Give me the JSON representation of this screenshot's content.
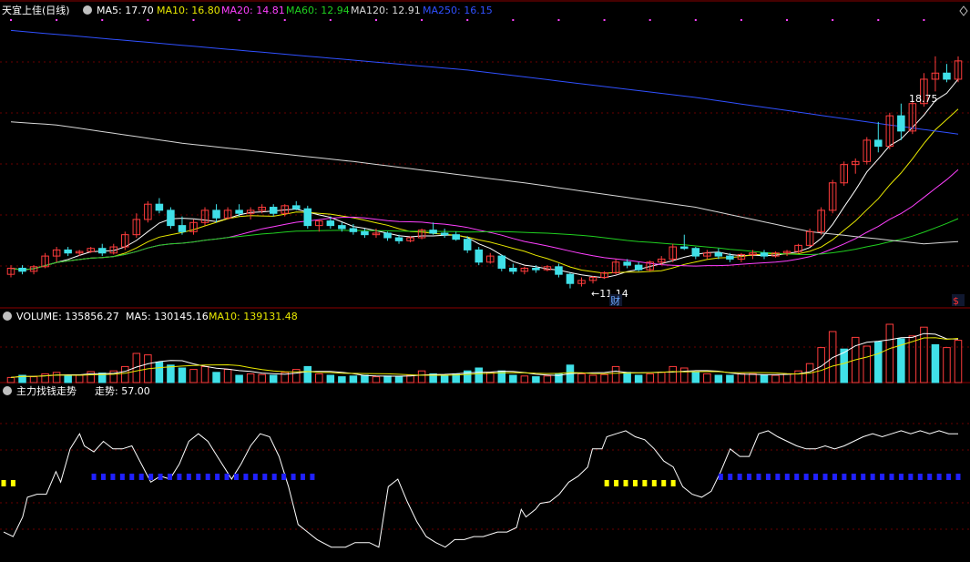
{
  "colors": {
    "background": "#000000",
    "frame": "#8b0000",
    "grid": "#6a0000",
    "up": "#ff3c3c",
    "down": "#40e0e8",
    "ma5": "#ffffff",
    "ma10": "#e8e800",
    "ma20": "#ff40ff",
    "ma60": "#20d020",
    "ma120": "#d8d8d8",
    "ma250": "#3050ff",
    "marker_yellow": "#ffff00",
    "marker_blue": "#2020ff",
    "dots": "#ff40ff"
  },
  "price_panel": {
    "title": "天宜上佳(日线)",
    "ma5": "MA5: 17.70",
    "ma10": "MA10: 16.80",
    "ma20": "MA20: 14.81",
    "ma60": "MA60: 12.94",
    "ma120": "MA120: 12.91",
    "ma250": "MA250: 16.15",
    "high_label": "18.75",
    "low_label": "←11.14",
    "badges": [
      {
        "text": "财",
        "color": "#6aa8ff",
        "x": 53
      },
      {
        "text": "$",
        "color": "#ff3030",
        "x": 83
      },
      {
        "text": "减",
        "color": "#40d040",
        "x": 93
      }
    ]
  },
  "volume_panel": {
    "title": "VOLUME: 135856.27",
    "ma5": "MA5: 130145.16",
    "ma10": "MA10: 139131.48"
  },
  "indicator_panel": {
    "title": "主力找钱走势",
    "value_label": "走势: 57.00"
  },
  "chart_data": {
    "type": "candlestick",
    "ylim": [
      10.5,
      20.0
    ],
    "candles": [
      [
        11.6,
        11.9,
        11.5,
        11.8
      ],
      [
        11.8,
        11.9,
        11.6,
        11.7
      ],
      [
        11.7,
        11.9,
        11.6,
        11.85
      ],
      [
        11.85,
        12.3,
        11.8,
        12.2
      ],
      [
        12.2,
        12.5,
        12.0,
        12.4
      ],
      [
        12.4,
        12.5,
        12.2,
        12.3
      ],
      [
        12.3,
        12.4,
        12.2,
        12.35
      ],
      [
        12.35,
        12.5,
        12.3,
        12.45
      ],
      [
        12.45,
        12.6,
        12.2,
        12.3
      ],
      [
        12.3,
        12.6,
        12.25,
        12.5
      ],
      [
        12.5,
        13.0,
        12.4,
        12.9
      ],
      [
        12.9,
        13.6,
        12.8,
        13.4
      ],
      [
        13.4,
        14.0,
        13.3,
        13.9
      ],
      [
        13.9,
        14.1,
        13.6,
        13.7
      ],
      [
        13.7,
        13.8,
        13.1,
        13.2
      ],
      [
        13.2,
        13.5,
        12.9,
        13.0
      ],
      [
        13.0,
        13.4,
        12.9,
        13.3
      ],
      [
        13.3,
        13.8,
        13.2,
        13.7
      ],
      [
        13.7,
        13.9,
        13.3,
        13.45
      ],
      [
        13.45,
        13.8,
        13.4,
        13.7
      ],
      [
        13.7,
        13.9,
        13.5,
        13.6
      ],
      [
        13.6,
        13.8,
        13.4,
        13.7
      ],
      [
        13.7,
        13.9,
        13.6,
        13.8
      ],
      [
        13.8,
        13.9,
        13.5,
        13.6
      ],
      [
        13.6,
        13.9,
        13.5,
        13.85
      ],
      [
        13.85,
        14.0,
        13.7,
        13.75
      ],
      [
        13.75,
        13.85,
        13.1,
        13.2
      ],
      [
        13.2,
        13.4,
        13.0,
        13.35
      ],
      [
        13.35,
        13.5,
        13.1,
        13.2
      ],
      [
        13.2,
        13.3,
        13.0,
        13.1
      ],
      [
        13.1,
        13.25,
        12.9,
        13.0
      ],
      [
        13.0,
        13.1,
        12.8,
        12.9
      ],
      [
        12.9,
        13.1,
        12.8,
        12.95
      ],
      [
        12.95,
        13.0,
        12.7,
        12.8
      ],
      [
        12.8,
        12.9,
        12.6,
        12.7
      ],
      [
        12.7,
        12.85,
        12.65,
        12.8
      ],
      [
        12.8,
        13.1,
        12.75,
        13.05
      ],
      [
        13.05,
        13.3,
        12.9,
        12.95
      ],
      [
        12.95,
        13.1,
        12.8,
        12.9
      ],
      [
        12.9,
        13.0,
        12.7,
        12.75
      ],
      [
        12.75,
        12.85,
        12.3,
        12.4
      ],
      [
        12.4,
        12.5,
        11.9,
        12.0
      ],
      [
        12.0,
        12.3,
        11.95,
        12.2
      ],
      [
        12.2,
        12.25,
        11.7,
        11.8
      ],
      [
        11.8,
        11.95,
        11.6,
        11.7
      ],
      [
        11.7,
        11.85,
        11.6,
        11.8
      ],
      [
        11.8,
        11.9,
        11.65,
        11.75
      ],
      [
        11.75,
        11.9,
        11.7,
        11.85
      ],
      [
        11.85,
        11.95,
        11.5,
        11.6
      ],
      [
        11.6,
        11.65,
        11.14,
        11.3
      ],
      [
        11.3,
        11.5,
        11.2,
        11.4
      ],
      [
        11.4,
        11.55,
        11.3,
        11.5
      ],
      [
        11.5,
        11.7,
        11.45,
        11.65
      ],
      [
        11.65,
        12.1,
        11.6,
        12.0
      ],
      [
        12.0,
        12.1,
        11.8,
        11.9
      ],
      [
        11.9,
        12.0,
        11.7,
        11.75
      ],
      [
        11.75,
        12.05,
        11.7,
        12.0
      ],
      [
        12.0,
        12.2,
        11.9,
        12.1
      ],
      [
        12.1,
        12.6,
        12.0,
        12.5
      ],
      [
        12.5,
        12.9,
        12.4,
        12.45
      ],
      [
        12.45,
        12.5,
        12.1,
        12.2
      ],
      [
        12.2,
        12.4,
        12.1,
        12.3
      ],
      [
        12.3,
        12.45,
        12.1,
        12.2
      ],
      [
        12.2,
        12.3,
        12.0,
        12.1
      ],
      [
        12.1,
        12.3,
        12.0,
        12.25
      ],
      [
        12.25,
        12.4,
        12.1,
        12.3
      ],
      [
        12.3,
        12.4,
        12.1,
        12.2
      ],
      [
        12.2,
        12.35,
        12.15,
        12.3
      ],
      [
        12.3,
        12.4,
        12.2,
        12.35
      ],
      [
        12.35,
        12.6,
        12.3,
        12.55
      ],
      [
        12.55,
        13.1,
        12.5,
        13.0
      ],
      [
        13.0,
        13.8,
        12.9,
        13.7
      ],
      [
        13.7,
        14.7,
        13.6,
        14.6
      ],
      [
        14.6,
        15.3,
        14.5,
        15.2
      ],
      [
        15.2,
        15.4,
        14.9,
        15.3
      ],
      [
        15.3,
        16.1,
        15.2,
        16.0
      ],
      [
        16.0,
        16.6,
        15.6,
        15.8
      ],
      [
        15.8,
        16.9,
        15.7,
        16.8
      ],
      [
        16.8,
        17.2,
        16.0,
        16.3
      ],
      [
        16.3,
        17.3,
        16.2,
        17.2
      ],
      [
        17.2,
        18.2,
        17.1,
        18.0
      ],
      [
        18.0,
        18.75,
        17.6,
        18.2
      ],
      [
        18.2,
        18.5,
        17.9,
        18.0
      ],
      [
        18.0,
        18.75,
        17.9,
        18.6
      ]
    ],
    "ma120": [
      [
        0,
        16.6
      ],
      [
        4,
        16.5
      ],
      [
        15,
        15.9
      ],
      [
        30,
        15.3
      ],
      [
        45,
        14.6
      ],
      [
        60,
        13.8
      ],
      [
        70,
        13.0
      ],
      [
        80,
        12.6
      ],
      [
        84,
        12.7
      ]
    ],
    "ma250": [
      [
        0,
        19.6
      ],
      [
        40,
        18.3
      ],
      [
        60,
        17.4
      ],
      [
        75,
        16.6
      ],
      [
        84,
        16.15
      ]
    ],
    "volume": [
      {
        "v": 7,
        "up": true
      },
      {
        "v": 10,
        "up": false
      },
      {
        "v": 8,
        "up": true
      },
      {
        "v": 12,
        "up": true
      },
      {
        "v": 14,
        "up": true
      },
      {
        "v": 9,
        "up": false
      },
      {
        "v": 10,
        "up": true
      },
      {
        "v": 15,
        "up": true
      },
      {
        "v": 13,
        "up": false
      },
      {
        "v": 16,
        "up": true
      },
      {
        "v": 22,
        "up": true
      },
      {
        "v": 40,
        "up": true
      },
      {
        "v": 38,
        "up": true
      },
      {
        "v": 28,
        "up": false
      },
      {
        "v": 24,
        "up": false
      },
      {
        "v": 20,
        "up": false
      },
      {
        "v": 18,
        "up": true
      },
      {
        "v": 22,
        "up": true
      },
      {
        "v": 14,
        "up": false
      },
      {
        "v": 18,
        "up": true
      },
      {
        "v": 10,
        "up": false
      },
      {
        "v": 12,
        "up": true
      },
      {
        "v": 11,
        "up": true
      },
      {
        "v": 10,
        "up": false
      },
      {
        "v": 14,
        "up": true
      },
      {
        "v": 18,
        "up": true
      },
      {
        "v": 22,
        "up": false
      },
      {
        "v": 12,
        "up": true
      },
      {
        "v": 10,
        "up": false
      },
      {
        "v": 8,
        "up": false
      },
      {
        "v": 9,
        "up": false
      },
      {
        "v": 10,
        "up": false
      },
      {
        "v": 8,
        "up": true
      },
      {
        "v": 9,
        "up": false
      },
      {
        "v": 8,
        "up": false
      },
      {
        "v": 10,
        "up": true
      },
      {
        "v": 16,
        "up": true
      },
      {
        "v": 12,
        "up": false
      },
      {
        "v": 10,
        "up": false
      },
      {
        "v": 12,
        "up": false
      },
      {
        "v": 16,
        "up": false
      },
      {
        "v": 20,
        "up": false
      },
      {
        "v": 14,
        "up": true
      },
      {
        "v": 16,
        "up": false
      },
      {
        "v": 10,
        "up": false
      },
      {
        "v": 9,
        "up": true
      },
      {
        "v": 8,
        "up": false
      },
      {
        "v": 9,
        "up": true
      },
      {
        "v": 12,
        "up": false
      },
      {
        "v": 24,
        "up": false
      },
      {
        "v": 12,
        "up": true
      },
      {
        "v": 10,
        "up": true
      },
      {
        "v": 11,
        "up": true
      },
      {
        "v": 22,
        "up": true
      },
      {
        "v": 14,
        "up": false
      },
      {
        "v": 10,
        "up": false
      },
      {
        "v": 12,
        "up": true
      },
      {
        "v": 14,
        "up": true
      },
      {
        "v": 22,
        "up": true
      },
      {
        "v": 20,
        "up": true
      },
      {
        "v": 14,
        "up": false
      },
      {
        "v": 12,
        "up": true
      },
      {
        "v": 10,
        "up": false
      },
      {
        "v": 10,
        "up": false
      },
      {
        "v": 12,
        "up": true
      },
      {
        "v": 12,
        "up": true
      },
      {
        "v": 10,
        "up": false
      },
      {
        "v": 10,
        "up": true
      },
      {
        "v": 12,
        "up": true
      },
      {
        "v": 16,
        "up": true
      },
      {
        "v": 26,
        "up": true
      },
      {
        "v": 48,
        "up": true
      },
      {
        "v": 70,
        "up": true
      },
      {
        "v": 46,
        "up": false
      },
      {
        "v": 62,
        "up": true
      },
      {
        "v": 50,
        "up": true
      },
      {
        "v": 56,
        "up": false
      },
      {
        "v": 80,
        "up": true
      },
      {
        "v": 60,
        "up": false
      },
      {
        "v": 64,
        "up": true
      },
      {
        "v": 76,
        "up": true
      },
      {
        "v": 52,
        "up": false
      },
      {
        "v": 48,
        "up": true
      },
      {
        "v": 58,
        "up": true
      }
    ],
    "indicator": [
      [
        0,
        15
      ],
      [
        2,
        12
      ],
      [
        4,
        25
      ],
      [
        5,
        38
      ],
      [
        7,
        40
      ],
      [
        9,
        40
      ],
      [
        11,
        55
      ],
      [
        12,
        48
      ],
      [
        14,
        70
      ],
      [
        16,
        80
      ],
      [
        17,
        72
      ],
      [
        19,
        68
      ],
      [
        21,
        75
      ],
      [
        23,
        70
      ],
      [
        25,
        70
      ],
      [
        27,
        72
      ],
      [
        29,
        60
      ],
      [
        31,
        48
      ],
      [
        33,
        52
      ],
      [
        35,
        50
      ],
      [
        37,
        60
      ],
      [
        39,
        75
      ],
      [
        41,
        80
      ],
      [
        43,
        75
      ],
      [
        45,
        65
      ],
      [
        47,
        55
      ],
      [
        48,
        50
      ],
      [
        50,
        60
      ],
      [
        52,
        72
      ],
      [
        54,
        80
      ],
      [
        56,
        78
      ],
      [
        58,
        65
      ],
      [
        60,
        45
      ],
      [
        62,
        20
      ],
      [
        64,
        15
      ],
      [
        66,
        10
      ],
      [
        69,
        5
      ],
      [
        72,
        5
      ],
      [
        74,
        8
      ],
      [
        77,
        8
      ],
      [
        79,
        5
      ],
      [
        81,
        45
      ],
      [
        83,
        50
      ],
      [
        85,
        35
      ],
      [
        87,
        22
      ],
      [
        89,
        12
      ],
      [
        91,
        8
      ],
      [
        93,
        5
      ],
      [
        95,
        10
      ],
      [
        97,
        10
      ],
      [
        99,
        12
      ],
      [
        101,
        12
      ],
      [
        104,
        15
      ],
      [
        106,
        15
      ],
      [
        108,
        18
      ],
      [
        109,
        30
      ],
      [
        110,
        25
      ],
      [
        112,
        30
      ],
      [
        113,
        34
      ],
      [
        115,
        35
      ],
      [
        117,
        40
      ],
      [
        119,
        48
      ],
      [
        121,
        52
      ],
      [
        123,
        58
      ],
      [
        124,
        70
      ],
      [
        126,
        70
      ],
      [
        127,
        78
      ],
      [
        129,
        80
      ],
      [
        131,
        82
      ],
      [
        133,
        78
      ],
      [
        135,
        76
      ],
      [
        137,
        70
      ],
      [
        139,
        62
      ],
      [
        141,
        58
      ],
      [
        143,
        45
      ],
      [
        145,
        40
      ],
      [
        147,
        38
      ],
      [
        149,
        42
      ],
      [
        151,
        55
      ],
      [
        153,
        70
      ],
      [
        155,
        65
      ],
      [
        157,
        65
      ],
      [
        159,
        80
      ],
      [
        161,
        82
      ],
      [
        163,
        78
      ],
      [
        165,
        75
      ],
      [
        167,
        72
      ],
      [
        169,
        70
      ],
      [
        171,
        70
      ],
      [
        173,
        72
      ],
      [
        175,
        70
      ],
      [
        177,
        72
      ],
      [
        179,
        75
      ],
      [
        181,
        78
      ],
      [
        183,
        80
      ],
      [
        185,
        78
      ],
      [
        187,
        80
      ],
      [
        189,
        82
      ],
      [
        191,
        80
      ],
      [
        193,
        82
      ],
      [
        195,
        80
      ],
      [
        197,
        82
      ],
      [
        199,
        80
      ],
      [
        201,
        80
      ]
    ],
    "yellow_markers": [
      [
        0,
        2
      ],
      [
        127,
        141
      ]
    ],
    "blue_markers": [
      [
        19,
        66
      ],
      [
        151,
        201
      ]
    ]
  }
}
